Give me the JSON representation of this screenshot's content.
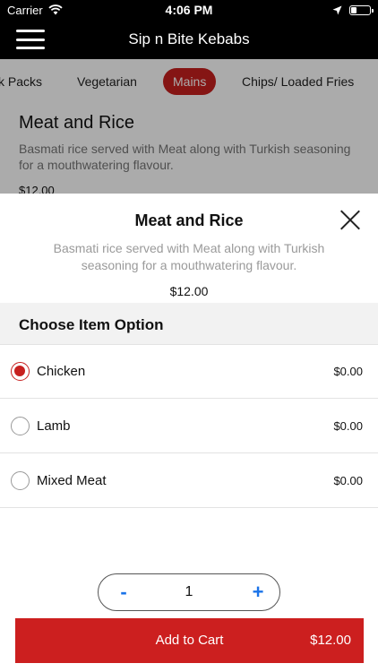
{
  "status_bar": {
    "carrier": "Carrier",
    "time": "4:06 PM",
    "icons": [
      "wifi-icon",
      "location-arrow-icon",
      "battery-icon"
    ]
  },
  "navbar": {
    "title": "Sip n Bite Kebabs",
    "menu_icon": "hamburger-icon"
  },
  "categories": {
    "items": [
      "k Packs",
      "Vegetarian",
      "Mains",
      "Chips/ Loaded Fries"
    ],
    "selected": "Mains"
  },
  "background_item": {
    "name": "Meat and Rice",
    "description": "Basmati rice served with Meat along with Turkish seasoning for a mouthwatering flavour.",
    "price": "$12.00"
  },
  "modal": {
    "title": "Meat and Rice",
    "description": "Basmati rice served with Meat along with Turkish seasoning for a mouthwatering flavour.",
    "price": "$12.00",
    "close_icon": "close-icon",
    "options_header": "Choose Item Option",
    "options": [
      {
        "label": "Chicken",
        "price": "$0.00",
        "selected": true
      },
      {
        "label": "Lamb",
        "price": "$0.00",
        "selected": false
      },
      {
        "label": "Mixed Meat",
        "price": "$0.00",
        "selected": false
      }
    ],
    "quantity": {
      "minus": "-",
      "value": "1",
      "plus": "+"
    },
    "add_to_cart": {
      "label": "Add to Cart",
      "total": "$12.00"
    }
  },
  "colors": {
    "accent": "#c7201f",
    "stepper_blue": "#1a73e8",
    "nav_bg": "#000000"
  }
}
